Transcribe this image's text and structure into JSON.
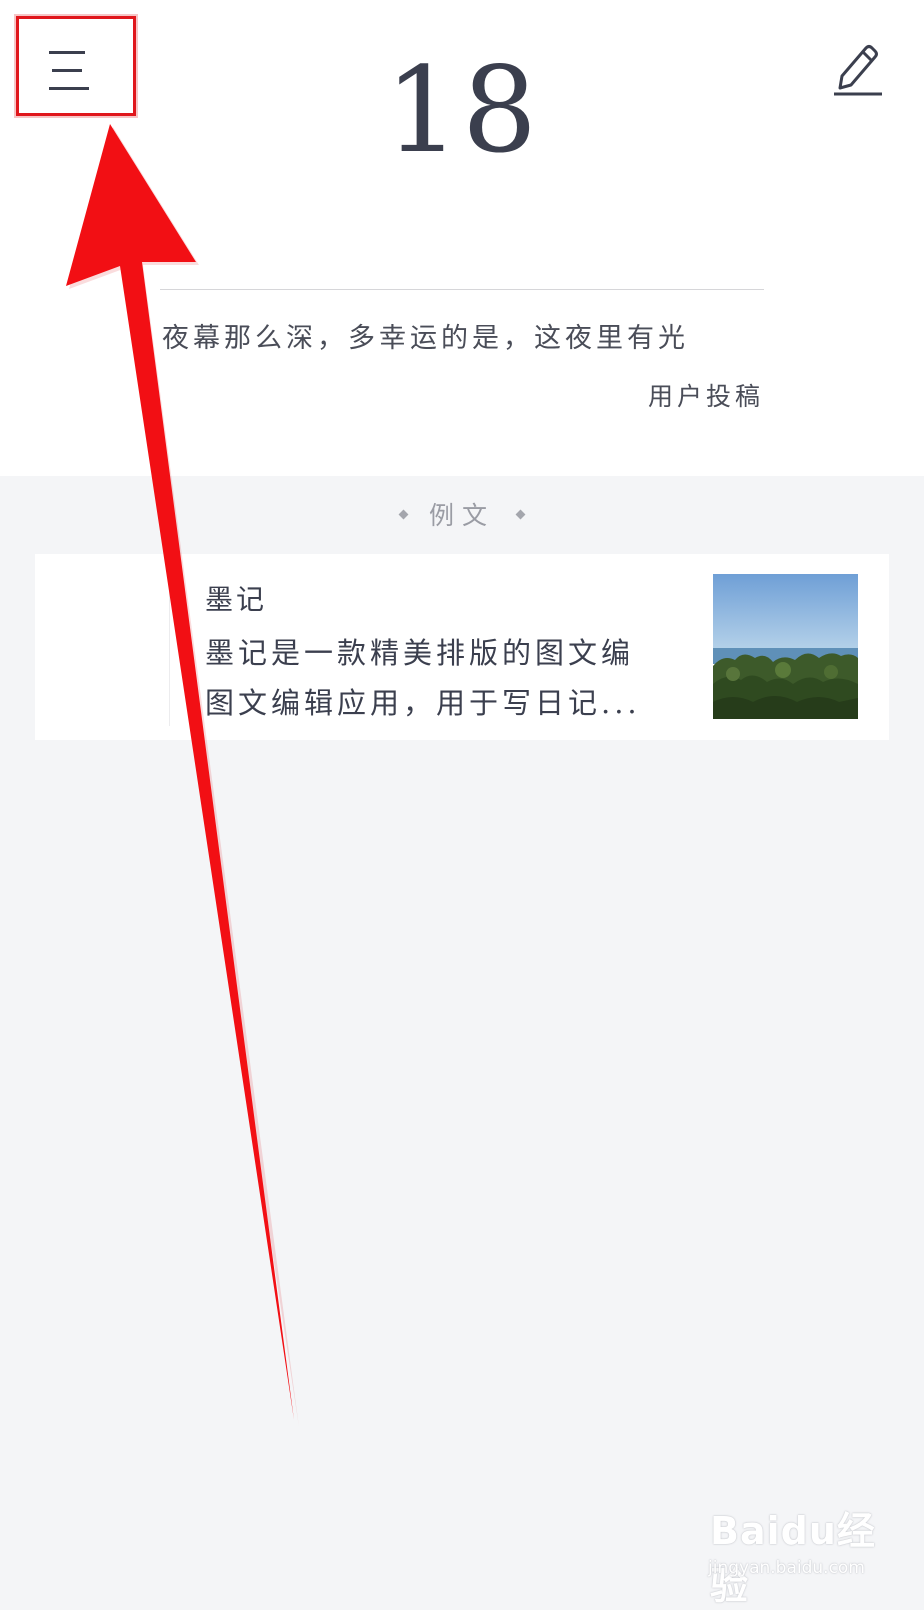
{
  "header": {
    "menu_icon": "hamburger-menu-icon",
    "day": "18",
    "edit_icon": "pencil-icon"
  },
  "quote": {
    "text": "夜幕那么深，多幸运的是，这夜里有光",
    "source": "用户投稿"
  },
  "section": {
    "label": "例文"
  },
  "article": {
    "title": "墨记",
    "line1": "墨记是一款精美排版的图文编",
    "line2": "图文编辑应用，用于写日记...",
    "thumbnail": "seaside-landscape-photo"
  },
  "annotation": {
    "color": "#e0161b",
    "type": "arrow-pointing-to-menu"
  },
  "watermark": {
    "brand": "Baidu经验",
    "url": "jingyan.baidu.com"
  }
}
